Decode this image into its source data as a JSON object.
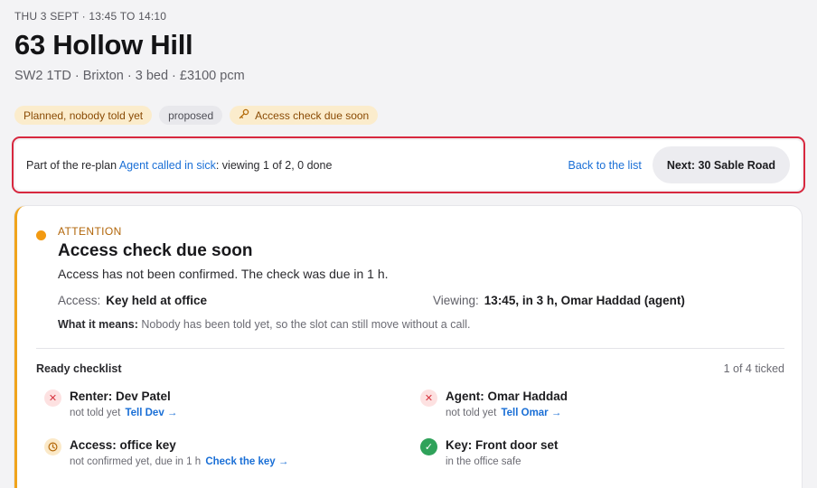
{
  "header": {
    "when": "THU 3 SEPT · 13:45 TO 14:10",
    "title": "63 Hollow Hill",
    "subtitle": "SW2 1TD · Brixton · 3 bed · £3100 pcm"
  },
  "chips": {
    "planned": "Planned, nobody told yet",
    "proposed": "proposed",
    "access": "Access check due soon",
    "access_icon": "key-icon"
  },
  "replan": {
    "prefix": "Part of the re-plan ",
    "link": "Agent called in sick",
    "suffix": ": viewing 1 of 2, 0 done",
    "back": "Back to the list",
    "next": "Next: 30 Sable Road"
  },
  "attention": {
    "label": "ATTENTION",
    "title": "Access check due soon",
    "description": "Access has not been confirmed. The check was due in 1 h.",
    "access_label": "Access:",
    "access_value": "Key held at office",
    "viewing_label": "Viewing:",
    "viewing_value": "13:45, in 3 h, Omar Haddad (agent)",
    "meaning_label": "What it means:",
    "meaning_text": " Nobody has been told yet, so the slot can still move without a call."
  },
  "checklist": {
    "title": "Ready checklist",
    "count": "1 of 4 ticked",
    "items": [
      {
        "name": "Renter: Dev Patel",
        "status": "not told yet",
        "action": "Tell Dev →",
        "icon": "x-circle-icon"
      },
      {
        "name": "Agent: Omar Haddad",
        "status": "not told yet",
        "action": "Tell Omar →",
        "icon": "x-circle-icon"
      },
      {
        "name": "Access: office key",
        "status": "not confirmed yet, due in 1 h",
        "action": "Check the key →",
        "icon": "clock-icon"
      },
      {
        "name": "Key: Front door set",
        "status": "in the office safe",
        "action": "",
        "icon": "check-circle-icon"
      }
    ]
  },
  "colors": {
    "accent": "#1a6fd6",
    "warning": "#f0a41c",
    "highlight": "#d7283f",
    "success": "#2fa25a"
  }
}
